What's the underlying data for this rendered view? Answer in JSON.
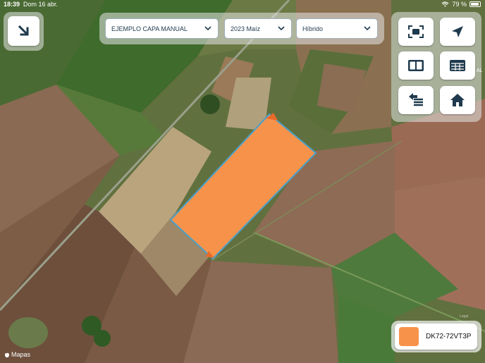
{
  "status_bar": {
    "time": "18:39",
    "date": "Dom 16 abr.",
    "battery": "79 %"
  },
  "filters": {
    "layer": "EJEMPLO CAPA MANUAL",
    "campaign": "2023 Maíz",
    "product": "Híbrido"
  },
  "toolbar": {
    "icons": [
      "fit-bounds-icon",
      "locate-icon",
      "split-view-icon",
      "table-icon",
      "layers-transfer-icon",
      "home-icon"
    ]
  },
  "legend": {
    "color": "#f7924a",
    "label": "DK72-72VT3P"
  },
  "map": {
    "attribution": "Mapas",
    "legal": "Legal",
    "road_label": "AL"
  },
  "colors": {
    "accent": "#1f3a4d",
    "field_fill": "#f7924a"
  }
}
